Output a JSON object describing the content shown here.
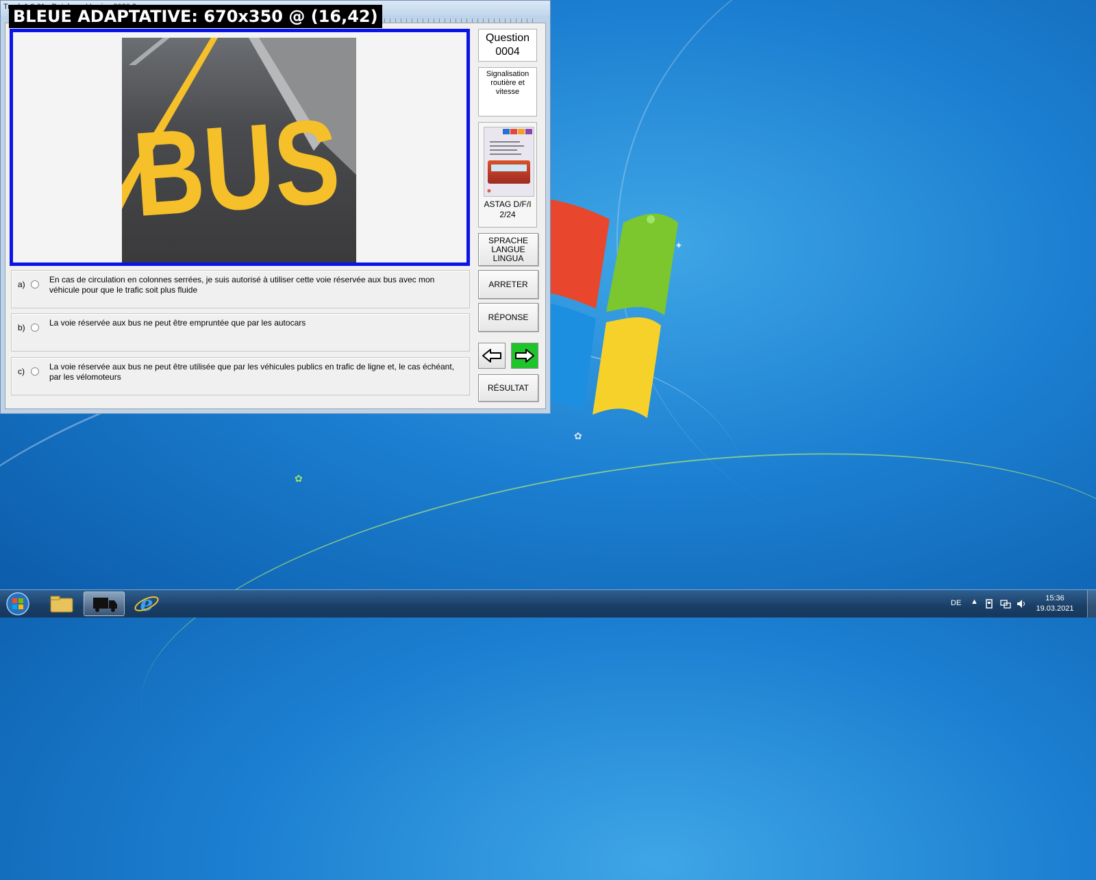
{
  "window": {
    "title": "Truck 1.3.61 - Database Version 2020.2",
    "overlay_label": "BLEUE ADAPTATIVE: 670x350 @ (16,42)"
  },
  "question": {
    "label": "Question",
    "number": "0004",
    "category": "Signalisation routière et vitesse",
    "book_caption_line1": "ASTAG D/F/I",
    "book_caption_line2": "2/24",
    "road_marking_text": "BUS"
  },
  "answers": [
    {
      "letter": "a)",
      "text": "En cas de circulation en colonnes serrées, je suis autorisé à utiliser cette voie réservée aux bus avec mon véhicule pour que le trafic soit plus fluide"
    },
    {
      "letter": "b)",
      "text": "La voie réservée aux bus ne peut être empruntée que par les autocars"
    },
    {
      "letter": "c)",
      "text": "La voie réservée aux bus ne peut être utilisée que par les véhicules publics en trafic de ligne et, le cas échéant, par les vélomoteurs"
    }
  ],
  "buttons": {
    "language": "SPRACHE LANGUE LINGUA",
    "stop": "ARRETER",
    "answer": "RÉPONSE",
    "result": "RÉSULTAT"
  },
  "taskbar": {
    "language": "DE",
    "time": "15:36",
    "date": "19.03.2021"
  },
  "colors": {
    "image_frame": "#0a14e6",
    "next_button": "#1fc42a",
    "road_marking": "#f5c02a"
  }
}
